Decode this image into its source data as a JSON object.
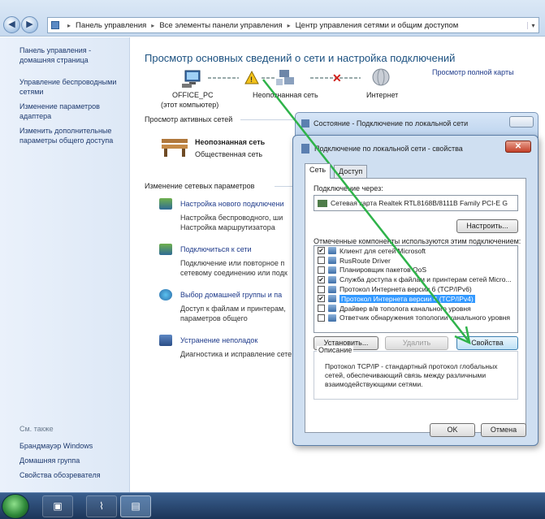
{
  "address": {
    "crumbs": [
      "Панель управления",
      "Все элементы панели управления",
      "Центр управления сетями и общим доступом"
    ]
  },
  "sidebar": {
    "home": "Панель управления - домашняя страница",
    "links": [
      "Управление беспроводными сетями",
      "Изменение параметров адаптера",
      "Изменить дополнительные параметры общего доступа"
    ],
    "see_also": "См. также",
    "see_also_links": [
      "Брандмауэр Windows",
      "Домашняя группа",
      "Свойства обозревателя"
    ]
  },
  "main": {
    "title": "Просмотр основных сведений о сети и настройка подключений",
    "full_map": "Просмотр полной карты",
    "map": {
      "pc_name": "OFFICE_PC",
      "pc_sub": "(этот компьютер)",
      "unknown_net": "Неопознанная сеть",
      "internet": "Интернет"
    },
    "active_header": "Просмотр активных сетей",
    "active_net_name": "Неопознанная сеть",
    "active_net_type": "Общественная сеть",
    "change_header": "Изменение сетевых параметров",
    "tasks": [
      {
        "link": "Настройка нового подключени",
        "desc1": "Настройка беспроводного, ши",
        "desc2": "Настройка маршрутизатора"
      },
      {
        "link": "Подключиться к сети",
        "desc1": "Подключение или повторное п",
        "desc2": "сетевому соединению или подк"
      },
      {
        "link": "Выбор домашней группы и па",
        "desc1": "Доступ к файлам и принтерам,",
        "desc2": "параметров общего"
      },
      {
        "link": "Устранение неполадок",
        "desc1": "Диагностика и исправление сете",
        "desc2": ""
      }
    ]
  },
  "status_dialog": {
    "title": "Состояние - Подключение по локальной сети"
  },
  "props_dialog": {
    "title": "Подключение по локальной сети - свойства",
    "close": "✕",
    "tabs": [
      "Сеть",
      "Доступ"
    ],
    "connect_via_label": "Подключение через:",
    "adapter": "Сетевая карта Realtek RTL8168B/8111B Family PCI-E G",
    "configure_btn": "Настроить...",
    "components_label": "Отмеченные компоненты используются этим подключением:",
    "components": [
      {
        "checked": "✔",
        "name": "Клиент для сетей Microsoft"
      },
      {
        "checked": "",
        "name": "RusRoute Driver"
      },
      {
        "checked": "",
        "name": "Планировщик пакетов QoS"
      },
      {
        "checked": "✔",
        "name": "Служба доступа к файлам и принтерам сетей Micro..."
      },
      {
        "checked": "",
        "name": "Протокол Интернета версии 6 (TCP/IPv6)"
      },
      {
        "checked": "✔",
        "name": "Протокол Интернета версии 4 (TCP/IPv4)"
      },
      {
        "checked": "",
        "name": "Драйвер в/в тополога канального уровня"
      },
      {
        "checked": "",
        "name": "Ответчик обнаружения топологии канального уровня"
      }
    ],
    "install_btn": "Установить...",
    "remove_btn": "Удалить",
    "props_btn": "Свойства",
    "desc_label": "Описание",
    "desc_text": "Протокол TCP/IP - стандартный протокол глобальных сетей, обеспечивающий связь между различными взаимодействующими сетями.",
    "ok_btn": "OK",
    "cancel_btn": "Отмена"
  },
  "colors": {
    "arrow": "#2fb34a",
    "link": "#1e3a8a",
    "title": "#1c5180"
  },
  "icons": [
    "back-icon",
    "forward-icon",
    "computer-icon",
    "warning-icon",
    "network-icon",
    "disconnected-icon",
    "globe-icon",
    "bench-icon"
  ]
}
